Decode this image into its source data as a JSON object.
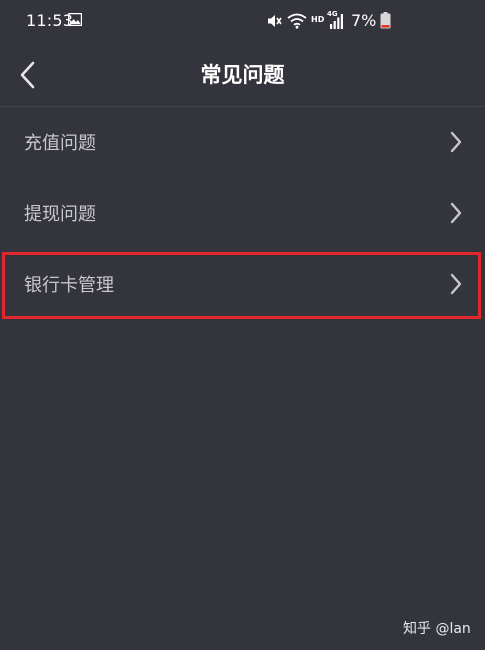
{
  "status_bar": {
    "time": "11:53",
    "network": "HD",
    "network_gen": "4G",
    "battery": "7%",
    "icons": [
      "gallery-icon",
      "mute-icon",
      "wifi-icon",
      "signal-icon",
      "battery-icon"
    ]
  },
  "nav": {
    "title": "常见问题",
    "back_icon": "chevron-left-icon"
  },
  "menu": {
    "items": [
      {
        "label": "充值问题"
      },
      {
        "label": "提现问题"
      },
      {
        "label": "银行卡管理",
        "highlighted": true
      }
    ]
  },
  "watermark": "知乎 @lan",
  "colors": {
    "background": "#34343d",
    "text": "#ffffff",
    "menu_text": "#c7c7cc",
    "highlight": "#e1262c",
    "divider": "#41414a"
  }
}
